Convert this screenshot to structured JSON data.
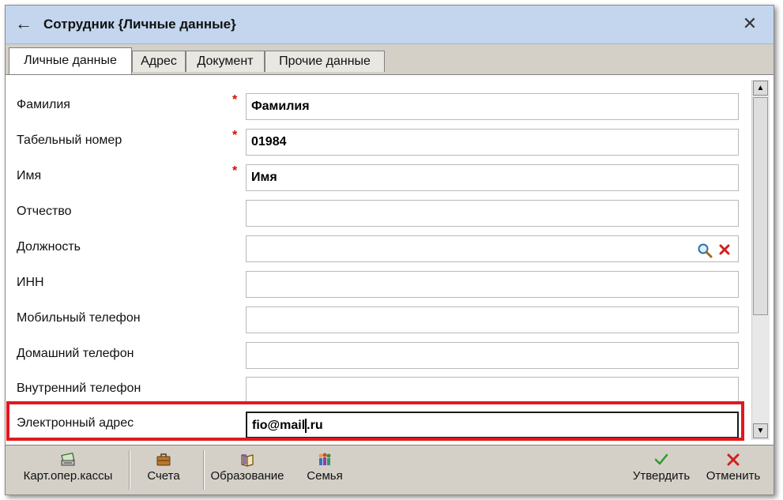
{
  "window": {
    "title": "Сотрудник {Личные данные}",
    "back_icon": "arrow-left-icon",
    "close_icon": "close-icon"
  },
  "tabs": [
    {
      "label": "Личные данные",
      "active": true
    },
    {
      "label": "Адрес",
      "active": false
    },
    {
      "label": "Документ",
      "active": false
    },
    {
      "label": "Прочие данные",
      "active": false
    }
  ],
  "form": {
    "required_mark": "*",
    "fields": [
      {
        "label": "Фамилия",
        "value": "Фамилия",
        "required": true
      },
      {
        "label": "Табельный номер",
        "value": "01984",
        "required": true
      },
      {
        "label": "Имя",
        "value": "Имя",
        "required": true
      },
      {
        "label": "Отчество",
        "value": "",
        "required": false
      },
      {
        "label": "Должность",
        "value": "",
        "required": false,
        "icons": [
          "search-icon",
          "clear-icon"
        ]
      },
      {
        "label": "ИНН",
        "value": "",
        "required": false
      },
      {
        "label": "Мобильный телефон",
        "value": "",
        "required": false
      },
      {
        "label": "Домашний телефон",
        "value": "",
        "required": false
      },
      {
        "label": "Внутренний телефон",
        "value": "",
        "required": false
      },
      {
        "label": "Электронный адрес",
        "value_before_caret": "fio@mail",
        "value_after_caret": ".ru",
        "required": false,
        "highlighted": true
      }
    ]
  },
  "toolbar": {
    "buttons_left": [
      {
        "label": "Карт.опер.кассы",
        "icon": "cash-register-icon"
      },
      {
        "label": "Счета",
        "icon": "briefcase-icon"
      },
      {
        "label": "Образование",
        "icon": "book-icon"
      },
      {
        "label": "Семья",
        "icon": "family-icon"
      }
    ],
    "buttons_right": [
      {
        "label": "Утвердить",
        "icon": "checkmark-icon"
      },
      {
        "label": "Отменить",
        "icon": "cancel-x-icon"
      }
    ]
  },
  "colors": {
    "titlebar": "#c3d6ee",
    "highlight_border": "#e0191f",
    "required_mark": "#cc1100",
    "chrome": "#d4d0c8"
  }
}
